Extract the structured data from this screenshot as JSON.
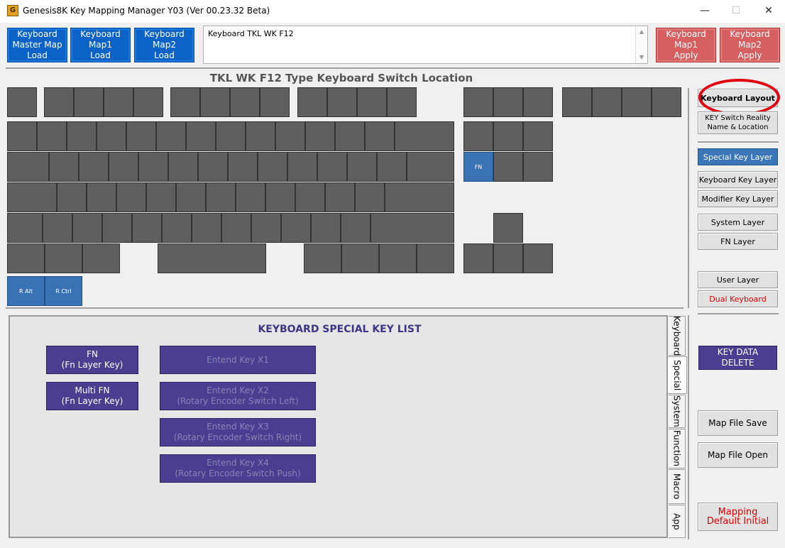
{
  "window": {
    "title": "Genesis8K Key Mapping Manager Y03 (Ver 00.23.32 Beta)",
    "icon_label": "G",
    "minimize": "—",
    "maximize": "☐",
    "close": "✕"
  },
  "top_buttons": {
    "master_load": "Keyboard\nMaster Map\nLoad",
    "map1_load": "Keyboard\nMap1\nLoad",
    "map2_load": "Keyboard\nMap2\nLoad",
    "map1_apply": "Keyboard\nMap1\nApply",
    "map2_apply": "Keyboard\nMap2\nApply"
  },
  "description": {
    "text": "Keyboard TKL WK F12",
    "scroll_up": "▲",
    "scroll_down": "▼"
  },
  "keyboard_area": {
    "title": "TKL WK F12 Type Keyboard Switch Location",
    "fn_key": "FN",
    "ralt_key": "R Alt",
    "rctrl_key": "R Ctrl"
  },
  "side_panel": {
    "keyboard_layout": "Keyboard Layout",
    "switch_reality": "KEY Switch Reality\nName & Location",
    "special_layer": "Special Key Layer",
    "keyboard_layer": "Keyboard Key Layer",
    "modifier_layer": "Modifier Key Layer",
    "system_layer": "System Layer",
    "fn_layer": "FN Layer",
    "user_layer": "User Layer",
    "dual_keyboard": "Dual Keyboard",
    "key_data_delete": "KEY DATA\nDELETE",
    "map_file_save": "Map File Save",
    "map_file_open": "Map File Open",
    "mapping_default": "Mapping\nDefault Initial"
  },
  "special_list": {
    "title": "KEYBOARD SPECIAL KEY LIST",
    "fn": "FN\n(Fn Layer Key)",
    "multi_fn": "Multi FN\n(Fn Layer Key)",
    "x1": "Entend Key X1",
    "x2": "Entend Key X2\n(Rotary Encoder Switch Left)",
    "x3": "Entend Key X3\n(Rotary Encoder Switch Right)",
    "x4": "Entend Key X4\n(Rotary Encoder Switch Push)"
  },
  "tabs": [
    "Keyboard",
    "Special",
    "System",
    "Function",
    "Macro",
    "App"
  ],
  "colors": {
    "blue_button": "#0b63c8",
    "red_button": "#d65f5f",
    "key_gray": "#5f5f5f",
    "key_blue": "#3a73b5",
    "purple": "#4b3d8f",
    "callout_red": "#e00010"
  }
}
